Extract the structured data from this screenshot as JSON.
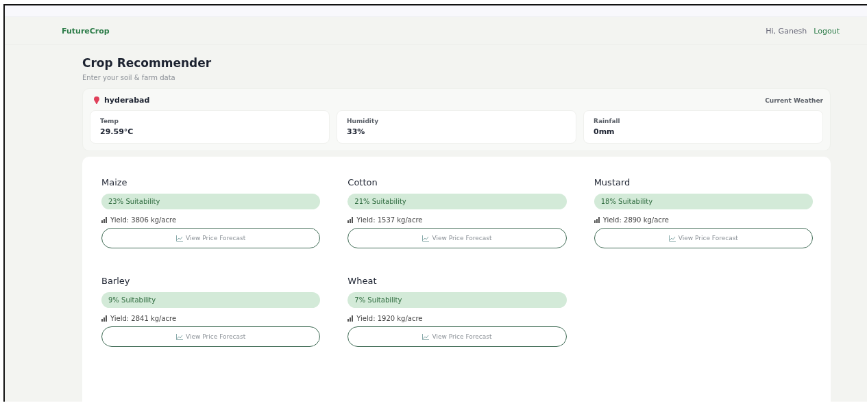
{
  "nav": {
    "brand": "FutureCrop",
    "greeting": "Hi, Ganesh",
    "logout": "Logout"
  },
  "header": {
    "title": "Crop Recommender",
    "subtitle": "Enter your soil & farm data"
  },
  "weather": {
    "location": "hyderabad",
    "label": "Current Weather",
    "stats": [
      {
        "label": "Temp",
        "value": "29.59°C"
      },
      {
        "label": "Humidity",
        "value": "33%"
      },
      {
        "label": "Rainfall",
        "value": "0mm"
      }
    ]
  },
  "crops": [
    {
      "name": "Maize",
      "suitability": "23% Suitability",
      "yield": "Yield: 3806 kg/acre",
      "button": "View Price Forecast"
    },
    {
      "name": "Cotton",
      "suitability": "21% Suitability",
      "yield": "Yield: 1537 kg/acre",
      "button": "View Price Forecast"
    },
    {
      "name": "Mustard",
      "suitability": "18% Suitability",
      "yield": "Yield: 2890 kg/acre",
      "button": "View Price Forecast"
    },
    {
      "name": "Barley",
      "suitability": "9% Suitability",
      "yield": "Yield: 2841 kg/acre",
      "button": "View Price Forecast"
    },
    {
      "name": "Wheat",
      "suitability": "7% Suitability",
      "yield": "Yield: 1920 kg/acre",
      "button": "View Price Forecast"
    }
  ]
}
